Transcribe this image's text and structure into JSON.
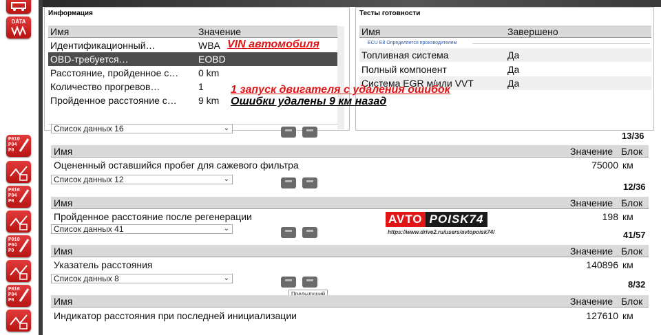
{
  "toolbar": {
    "buttons": [
      {
        "name": "diag",
        "icon": "car-scan-icon"
      },
      {
        "name": "data",
        "label": "DATA",
        "icon": "data-icon"
      },
      {
        "name": "dtc1",
        "code": "P010\nP04\nP0",
        "icon": "dtc-edit-icon"
      },
      {
        "name": "act1",
        "icon": "actuator-icon"
      },
      {
        "name": "dtc2",
        "code": "P010\nP04\nP0",
        "icon": "dtc-edit-icon"
      },
      {
        "name": "act2",
        "icon": "actuator-icon"
      },
      {
        "name": "dtc3",
        "code": "P010\nP04\nP0",
        "icon": "dtc-edit-icon"
      },
      {
        "name": "act3",
        "icon": "actuator-icon"
      },
      {
        "name": "dtc4",
        "code": "P010\nP04\nP0",
        "icon": "dtc-edit-icon"
      },
      {
        "name": "act4",
        "icon": "actuator-icon"
      }
    ]
  },
  "info": {
    "title": "Информация",
    "col_name": "Имя",
    "col_value": "Значение",
    "rows": [
      {
        "name": "Идентификационный…",
        "value": "WBA"
      },
      {
        "name": "OBD-требуется…",
        "value": "EOBD"
      },
      {
        "name": "Расстояние, пройденное с…",
        "value": "0 km"
      },
      {
        "name": "Количество прогревов…",
        "value": "1"
      },
      {
        "name": "Пройденное расстояние с…",
        "value": "9 km"
      }
    ]
  },
  "readiness": {
    "title": "Тесты готовности",
    "col_name": "Имя",
    "col_done": "Завершено",
    "ecu_note": "ECU E8 Определяется производителем",
    "rows": [
      {
        "name": "Топливная система",
        "done": "Да"
      },
      {
        "name": "Полный компонент",
        "done": "Да"
      },
      {
        "name": "Система EGR м/или VVT",
        "done": "Да"
      }
    ]
  },
  "annotations": {
    "vin": "VIN автомобиля",
    "start": "1 запуск двигателя с удаления ошибок",
    "cleared": "Ошибки удалены 9 км назад"
  },
  "blocks": [
    {
      "select": "Список данных 16",
      "counter": "13/36",
      "col_name": "Имя",
      "col_value": "Значение",
      "col_unit": "Блок",
      "row": {
        "name": "Оцененный оставшийся пробег для сажевого фильтра",
        "value": "75000",
        "unit": "км"
      }
    },
    {
      "select": "Список данных 12",
      "counter": "12/36",
      "col_name": "Имя",
      "col_value": "Значение",
      "col_unit": "Блок",
      "row": {
        "name": "Пройденное расстояние после регенерации",
        "value": "198",
        "unit": "км"
      }
    },
    {
      "select": "Список данных 41",
      "counter": "41/57",
      "col_name": "Имя",
      "col_value": "Значение",
      "col_unit": "Блок",
      "row": {
        "name": "Указатель расстояния",
        "value": "140896",
        "unit": "км"
      }
    },
    {
      "select": "Список данных 8",
      "counter": "8/32",
      "col_name": "Имя",
      "col_value": "Значение",
      "col_unit": "Блок",
      "row": {
        "name": "Индикатор расстояния при последней инициализации",
        "value": "127610",
        "unit": "км"
      }
    }
  ],
  "tooltip": "Предыдущий",
  "logo": {
    "part1": "AVTO",
    "part2": "POISK74",
    "url": "https://www.drive2.ru/users/avtopoisk74/"
  }
}
